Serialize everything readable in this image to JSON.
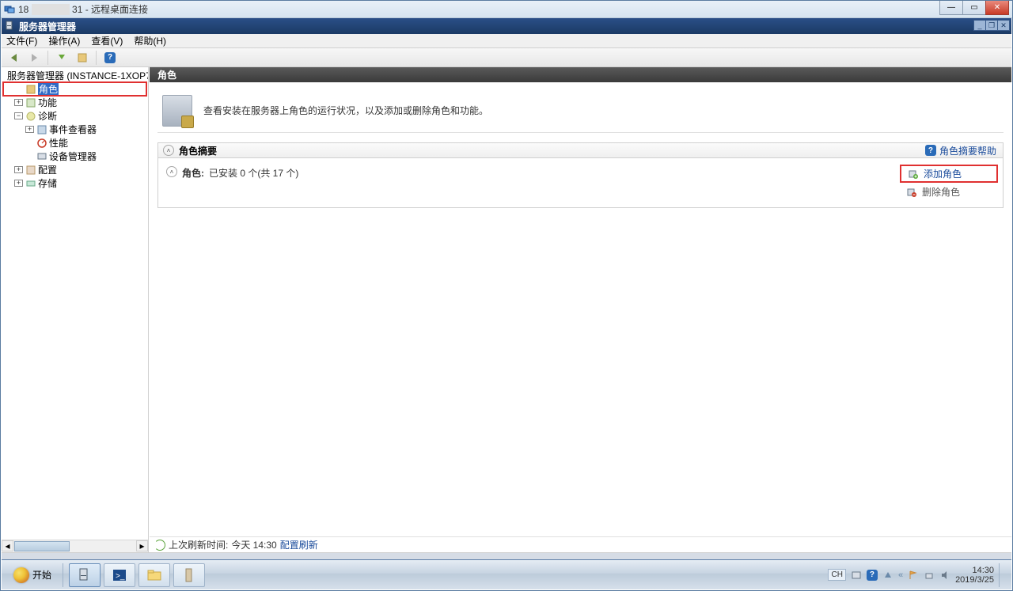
{
  "rdp": {
    "title_prefix": "18",
    "title_suffix": "31 - 远程桌面连接"
  },
  "inner_window": {
    "title": "服务器管理器"
  },
  "menubar": {
    "file": "文件(F)",
    "action": "操作(A)",
    "view": "查看(V)",
    "help": "帮助(H)"
  },
  "tree": {
    "root": "服务器管理器 (INSTANCE-1XOP7",
    "roles": "角色",
    "features": "功能",
    "diagnostics": "诊断",
    "event_viewer": "事件查看器",
    "performance": "性能",
    "device_manager": "设备管理器",
    "configuration": "配置",
    "storage": "存储"
  },
  "content": {
    "header": "角色",
    "intro": "查看安装在服务器上角色的运行状况，以及添加或删除角色和功能。",
    "summary_title": "角色摘要",
    "summary_help": "角色摘要帮助",
    "roles_label": "角色:",
    "roles_value": "已安装 0 个(共 17 个)",
    "add_role": "添加角色",
    "remove_role": "删除角色"
  },
  "status": {
    "prefix": "上次刷新时间:",
    "time": "今天 14:30",
    "config_refresh": "配置刷新"
  },
  "taskbar": {
    "start": "开始",
    "lang": "CH",
    "time": "14:30",
    "date": "2019/3/25"
  }
}
